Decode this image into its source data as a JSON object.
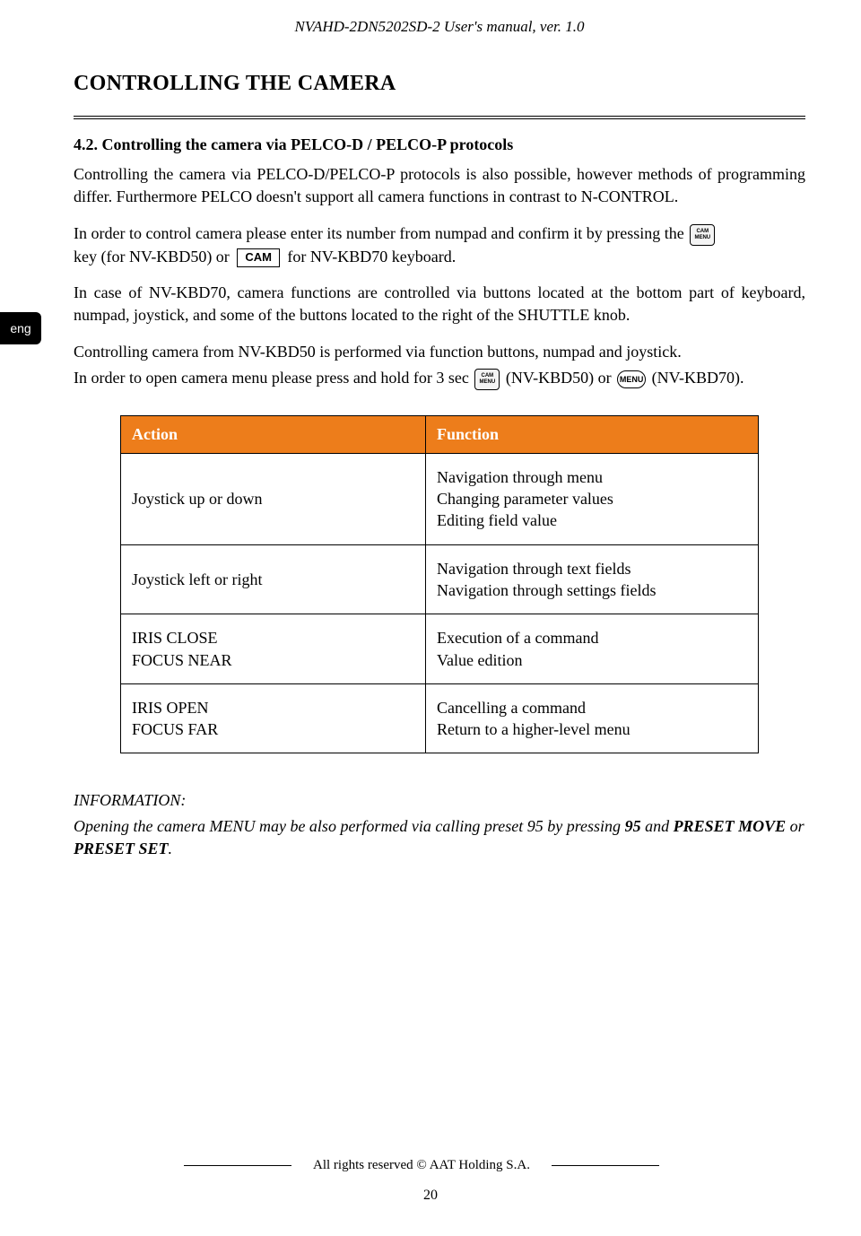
{
  "running_head": "NVAHD-2DN5202SD-2 User's manual, ver. 1.0",
  "section_title": "CONTROLLING THE CAMERA",
  "lang_tab": "eng",
  "subsection": "4.2. Controlling the camera via PELCO-D / PELCO-P protocols",
  "para1": "Controlling the camera via PELCO-D/PELCO-P protocols is also possible, however methods of programming differ. Furthermore PELCO doesn't support all camera functions in contrast to N-CONTROL.",
  "para2_a": "In order to control camera please enter its number from numpad and confirm it by pressing the",
  "para2_b": "key  (for NV-KBD50) or",
  "para2_c": "for NV-KBD70 keyboard.",
  "key_cam_menu_top": "CAM",
  "key_cam_menu_bot": "MENU",
  "key_cam_label": "CAM",
  "para3": "In case of NV-KBD70, camera functions are controlled via buttons located at the bottom part of keyboard, numpad, joystick, and some of the buttons located to the right of  the SHUTTLE knob.",
  "para4": "Controlling camera from NV-KBD50 is performed via function buttons, numpad and joystick.",
  "para5_a": "In order to open camera menu please press and hold for 3 sec",
  "para5_b": "(NV-KBD50) or",
  "para5_c": "(NV-KBD70).",
  "key_menu_round": "MENU",
  "table": {
    "header_action": "Action",
    "header_function": "Function",
    "rows": [
      {
        "action": "Joystick up or down",
        "function": "Navigation through menu\nChanging parameter values\nEditing field value"
      },
      {
        "action": "Joystick left or right",
        "function": "Navigation through text fields\nNavigation through settings fields"
      },
      {
        "action": "IRIS CLOSE\nFOCUS NEAR",
        "function": "Execution of a command\nValue edition"
      },
      {
        "action": "IRIS OPEN\nFOCUS FAR",
        "function": "Cancelling a command\nReturn to a higher-level menu"
      }
    ]
  },
  "info_title": "INFORMATION:",
  "info_body_a": "Opening the camera MENU may be also performed via calling preset 95 by pressing ",
  "info_body_b": "95",
  "info_body_c": " and ",
  "info_body_d": "PRESET MOVE",
  "info_body_e": " or ",
  "info_body_f": "PRESET SET",
  "info_body_g": ".",
  "footer_text": "All rights reserved © AAT Holding S.A.",
  "page_number": "20"
}
